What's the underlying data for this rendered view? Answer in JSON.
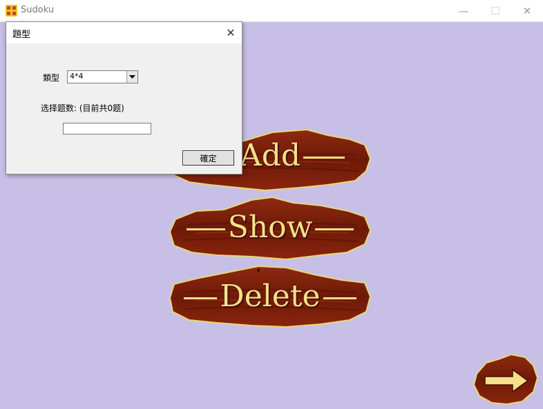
{
  "window": {
    "title": "Sudoku",
    "icon": "sudoku-app-icon",
    "minimize_glyph": "—",
    "maximize_glyph": "☐",
    "close_glyph": "✕"
  },
  "menu_signs": {
    "add_label": "Add",
    "show_label": "Show",
    "delete_label": "Delete",
    "next_icon": "arrow-right-icon"
  },
  "dialog": {
    "title": "題型",
    "close_glyph": "✕",
    "type_label": "類型",
    "type_value": "4*4",
    "count_label": "选择题数: (目前共0题)",
    "count_value": "",
    "ok_label": "確定"
  },
  "colors": {
    "background": "#c8bfe6",
    "wood": "#7a1e0c",
    "sign_text": "#f4e08a"
  }
}
